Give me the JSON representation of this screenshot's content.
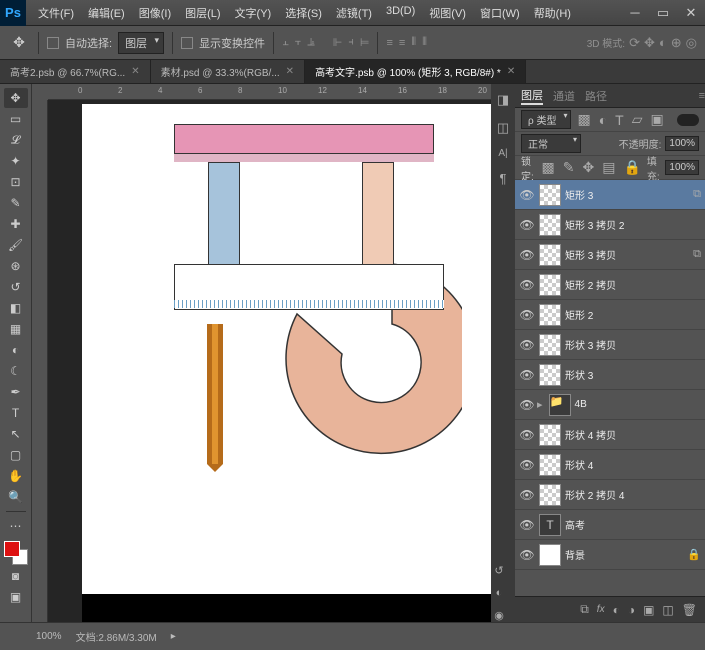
{
  "menu": [
    "文件(F)",
    "编辑(E)",
    "图像(I)",
    "图层(L)",
    "文字(Y)",
    "选择(S)",
    "滤镜(T)",
    "3D(D)",
    "视图(V)",
    "窗口(W)",
    "帮助(H)"
  ],
  "optbar": {
    "auto_select": "自动选择:",
    "kind": "图层",
    "show_controls": "显示变换控件",
    "mode_3d": "3D 模式:"
  },
  "tabs": [
    {
      "label": "高考2.psb @ 66.7%(RG...",
      "active": false
    },
    {
      "label": "素材.psd @ 33.3%(RGB/...",
      "active": false
    },
    {
      "label": "高考文字.psb @ 100% (矩形 3, RGB/8#) *",
      "active": true
    }
  ],
  "ruler_marks": [
    "0",
    "2",
    "4",
    "6",
    "8",
    "10",
    "12",
    "14",
    "16",
    "18",
    "20"
  ],
  "right_icons": [
    "⬚",
    "⬚",
    "A|",
    "⬚"
  ],
  "panel_tabs": {
    "layers": "图层",
    "channels": "通道",
    "paths": "路径"
  },
  "layer_opts": {
    "kind": "ρ 类型",
    "blend": "正常",
    "opacity_lbl": "不透明度:",
    "opacity": "100%",
    "lock_lbl": "锁定:",
    "fill_lbl": "填充:",
    "fill": "100%"
  },
  "layers": [
    {
      "name": "矩形 3",
      "link": true,
      "sel": true
    },
    {
      "name": "矩形 3 拷贝 2",
      "link": false
    },
    {
      "name": "矩形 3 拷贝",
      "link": true
    },
    {
      "name": "矩形 2 拷贝",
      "link": false
    },
    {
      "name": "矩形 2",
      "link": false
    },
    {
      "name": "形状 3 拷贝",
      "link": false
    },
    {
      "name": "形状 3",
      "link": false
    },
    {
      "name": "4B",
      "folder": true
    },
    {
      "name": "形状 4 拷贝",
      "link": false
    },
    {
      "name": "形状 4",
      "link": false
    },
    {
      "name": "形状 2 拷贝 4",
      "link": false
    },
    {
      "name": "高考",
      "text": true
    },
    {
      "name": "背景",
      "bg": true
    }
  ],
  "status": {
    "zoom": "100%",
    "doc": "文档:2.86M/3.30M"
  }
}
